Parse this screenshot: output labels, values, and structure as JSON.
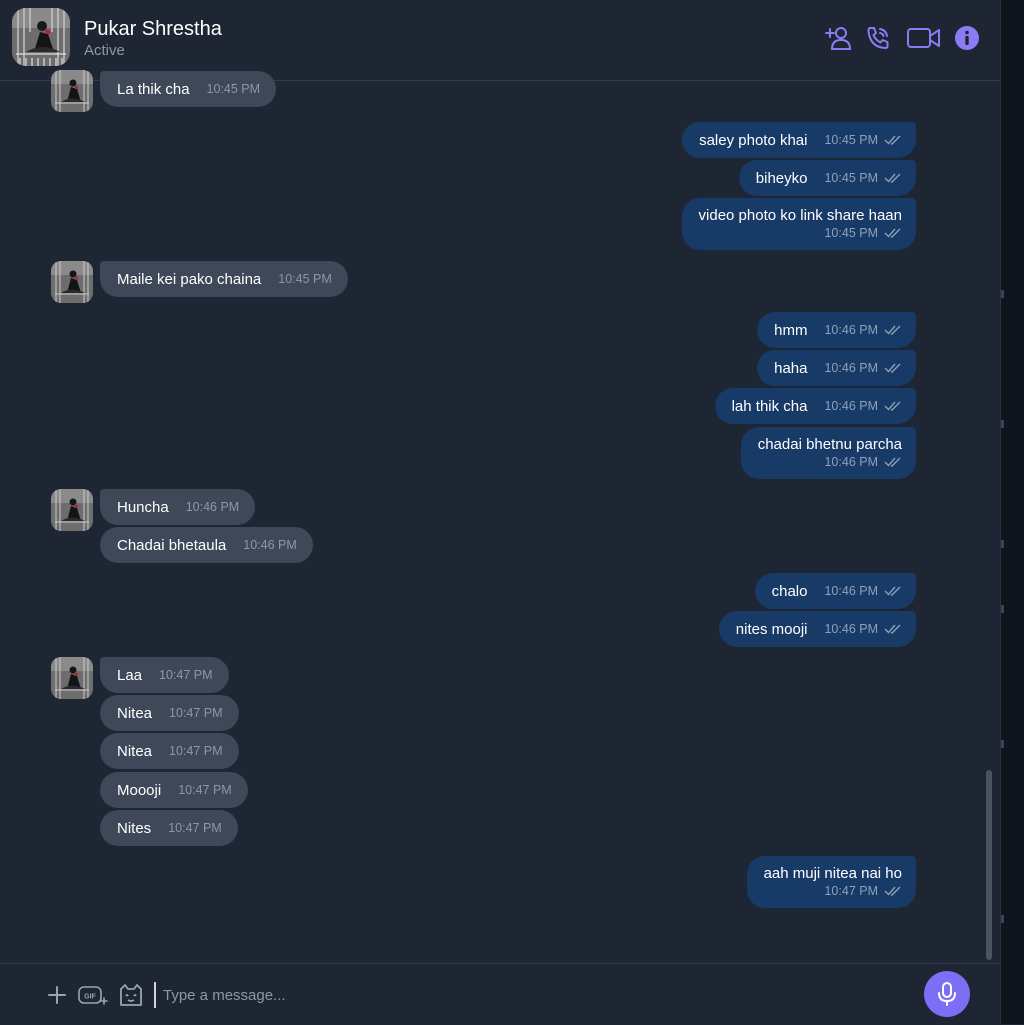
{
  "header": {
    "name": "Pukar Shrestha",
    "status": "Active",
    "icons": [
      "add-person-icon",
      "phone-icon",
      "video-camera-icon",
      "info-icon"
    ]
  },
  "colors": {
    "background": "#1e2533",
    "incoming_bubble": "#3f4858",
    "outgoing_bubble": "#183a66",
    "accent": "#7c6ef5"
  },
  "messages": [
    {
      "dir": "in",
      "text": "La thik cha",
      "time": "10:45 PM"
    },
    {
      "dir": "out",
      "text": "saley photo khai",
      "time": "10:45 PM"
    },
    {
      "dir": "out",
      "text": "biheyko",
      "time": "10:45 PM"
    },
    {
      "dir": "out",
      "text": "video photo ko link share haan",
      "time": "10:45 PM"
    },
    {
      "dir": "in",
      "text": "Maile kei pako chaina",
      "time": "10:45 PM"
    },
    {
      "dir": "out",
      "text": "hmm",
      "time": "10:46 PM"
    },
    {
      "dir": "out",
      "text": "haha",
      "time": "10:46 PM"
    },
    {
      "dir": "out",
      "text": "lah thik cha",
      "time": "10:46 PM"
    },
    {
      "dir": "out",
      "text": "chadai bhetnu parcha",
      "time": "10:46 PM"
    },
    {
      "dir": "in",
      "text": "Huncha",
      "time": "10:46 PM"
    },
    {
      "dir": "in",
      "text": "Chadai bhetaula",
      "time": "10:46 PM"
    },
    {
      "dir": "out",
      "text": "chalo",
      "time": "10:46 PM"
    },
    {
      "dir": "out",
      "text": "nites mooji",
      "time": "10:46 PM"
    },
    {
      "dir": "in",
      "text": "Laa",
      "time": "10:47 PM"
    },
    {
      "dir": "in",
      "text": "Nitea",
      "time": "10:47 PM"
    },
    {
      "dir": "in",
      "text": "Nitea",
      "time": "10:47 PM"
    },
    {
      "dir": "in",
      "text": "Moooji",
      "time": "10:47 PM"
    },
    {
      "dir": "in",
      "text": "Nites",
      "time": "10:47 PM"
    },
    {
      "dir": "out",
      "text": "aah muji nitea nai ho",
      "time": "10:47 PM"
    }
  ],
  "composer": {
    "placeholder": "Type a message...",
    "icons": [
      "plus-icon",
      "gif-icon",
      "sticker-icon",
      "microphone-icon"
    ]
  }
}
